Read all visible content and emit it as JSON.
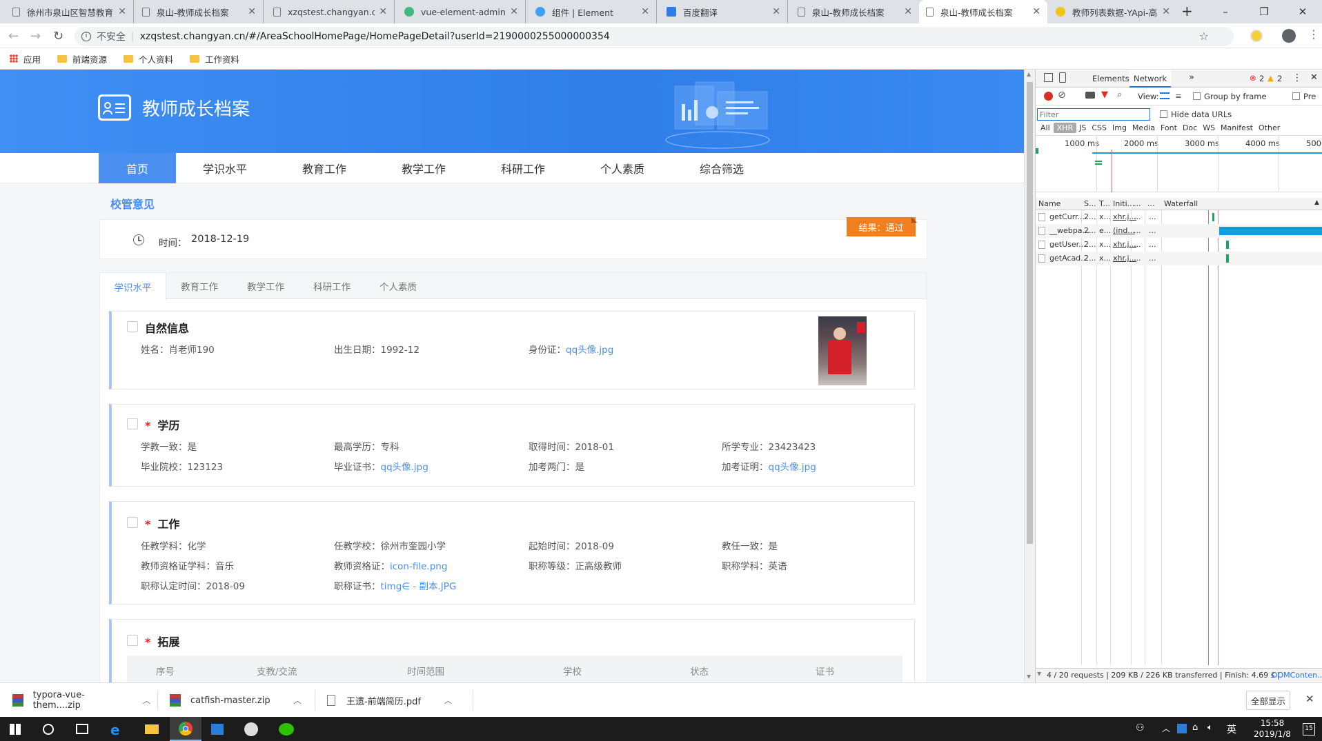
{
  "browser": {
    "tabs": [
      {
        "title": "徐州市泉山区智慧教育",
        "active": false
      },
      {
        "title": "泉山-教师成长档案",
        "active": false
      },
      {
        "title": "xzqstest.changyan.cn",
        "active": false
      },
      {
        "title": "vue-element-admin",
        "active": false
      },
      {
        "title": "组件 | Element",
        "active": false
      },
      {
        "title": "百度翻译",
        "active": false
      },
      {
        "title": "泉山-教师成长档案",
        "active": false
      },
      {
        "title": "泉山-教师成长档案",
        "active": true
      },
      {
        "title": "教师列表数据-YApi-高",
        "active": false
      }
    ],
    "security_label": "不安全",
    "url": "xzqstest.changyan.cn/#/AreaSchoolHomePage/HomePageDetail?userId=2190000255000000354",
    "bookmarks": [
      "应用",
      "前端资源",
      "个人资料",
      "工作资料"
    ]
  },
  "app": {
    "title": "教师成长档案",
    "nav": [
      "首页",
      "学识水平",
      "教育工作",
      "教学工作",
      "科研工作",
      "个人素质",
      "综合筛选"
    ],
    "opinion_title": "校管意见",
    "time_label": "时间：",
    "time_value": "2018-12-19",
    "result_label": "结果：",
    "result_value": "通过",
    "tabs": [
      "学识水平",
      "教育工作",
      "教学工作",
      "科研工作",
      "个人素质"
    ],
    "natural": {
      "title": "自然信息",
      "name": "姓名：肖老师190",
      "birth": "出生日期：1992-12",
      "idcard_label": "身份证：",
      "idcard_file": "qq头像.jpg"
    },
    "education": {
      "title": "学历",
      "r1": [
        "学教一致：是",
        "最高学历：专科",
        "取得时间：2018-01",
        "所学专业：23423423"
      ],
      "r2_0": "毕业院校：123123",
      "r2_1_label": "毕业证书：",
      "r2_1_file": "qq头像.jpg",
      "r2_2": "加考两门：是",
      "r2_3_label": "加考证明：",
      "r2_3_file": "qq头像.jpg"
    },
    "work": {
      "title": "工作",
      "r1": [
        "任教学科：化学",
        "任教学校：徐州市奎园小学",
        "起始时间：2018-09",
        "教任一致：是"
      ],
      "r2_0": "教师资格证学科：音乐",
      "r2_1_label": "教师资格证：",
      "r2_1_file": "icon-file.png",
      "r2_2": "职称等级：正高级教师",
      "r2_3": "职称学科：英语",
      "r3_0": "职称认定时间：2018-09",
      "r3_1_label": "职称证书：",
      "r3_1_file": "timg∈ - 副本.JPG"
    },
    "expand": {
      "title": "拓展",
      "columns": [
        "序号",
        "支教/交流",
        "时间范围",
        "学校",
        "状态",
        "证书"
      ]
    }
  },
  "devtools": {
    "tabs": [
      "Elements",
      "Network"
    ],
    "errors": "2",
    "warnings": "2",
    "view_label": "View:",
    "group_by_frame": "Group by frame",
    "preserve": "Pre",
    "filter_placeholder": "Filter",
    "hide_data_urls": "Hide data URLs",
    "types": [
      "All",
      "XHR",
      "JS",
      "CSS",
      "Img",
      "Media",
      "Font",
      "Doc",
      "WS",
      "Manifest",
      "Other"
    ],
    "ticks": [
      "1000 ms",
      "2000 ms",
      "3000 ms",
      "4000 ms",
      "5000"
    ],
    "columns": [
      "Name",
      "S...",
      "T...",
      "Initi...",
      "...",
      "...",
      "Waterfall"
    ],
    "rows": [
      {
        "name": "getCurr...",
        "s": "2...",
        "t": "x...",
        "init": "xhr.j...",
        "a": "...",
        "b": "..."
      },
      {
        "name": "__webpa...",
        "s": "2...",
        "t": "e...",
        "init": "(ind...",
        "a": "...",
        "b": "..."
      },
      {
        "name": "getUser...",
        "s": "2...",
        "t": "x...",
        "init": "xhr.j...",
        "a": "...",
        "b": "..."
      },
      {
        "name": "getAcad...",
        "s": "2...",
        "t": "x...",
        "init": "xhr.j...",
        "a": "...",
        "b": "..."
      }
    ],
    "status": "4 / 20 requests | 209 KB / 226 KB transferred | Finish: 4.69 s |",
    "dom_content": "DOMConten..."
  },
  "downloads": {
    "items": [
      "typora-vue-them....zip",
      "catfish-master.zip",
      "王遗-前端简历.pdf"
    ],
    "show_all": "全部显示"
  },
  "taskbar": {
    "ime": "英",
    "time": "15:58",
    "date": "2019/1/8",
    "badge": "15"
  }
}
